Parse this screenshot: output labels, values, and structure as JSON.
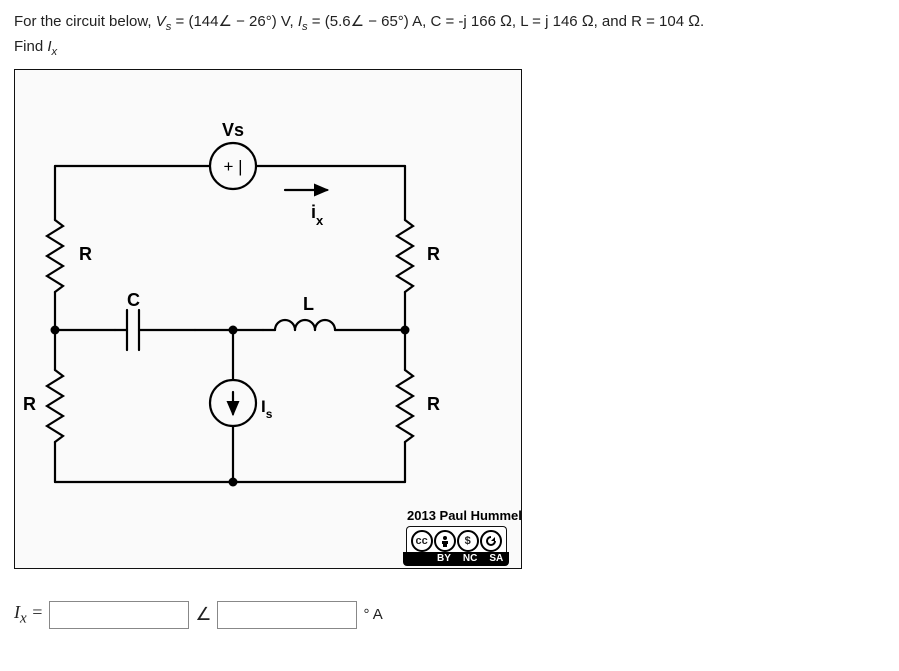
{
  "problem": {
    "intro": "For the circuit below, ",
    "vs_lhs": "V",
    "vs_sub": "s",
    "vs_eq": " = (144∠ − 26°) V, ",
    "is_lhs": "I",
    "is_sub": "s",
    "is_eq": " = (5.6∠ − 65°) A, C = -j 166 ",
    "ohm1": "Ω",
    "mid1": ", L = j 146 ",
    "ohm2": "Ω",
    "mid2": ", and R = 104 ",
    "ohm3": "Ω",
    "period": ".",
    "find": "Find ",
    "find_sym": "I",
    "find_sub": "x"
  },
  "diagram": {
    "vs_label": "Vs",
    "vs_sign": "+ |",
    "ix_label": "i",
    "ix_sub": "x",
    "is_label": "I",
    "is_sub": "s",
    "R": "R",
    "C": "C",
    "L": "L",
    "attribution": "2013 Paul Hummel",
    "cc": {
      "cc": "cc",
      "by": "BY",
      "nc": "NC",
      "sa": "SA"
    }
  },
  "answer": {
    "lhs": "I",
    "lhs_sub": "x",
    "eq": " =",
    "angle": "∠",
    "unit": "° A",
    "mag_value": "",
    "ang_value": ""
  }
}
